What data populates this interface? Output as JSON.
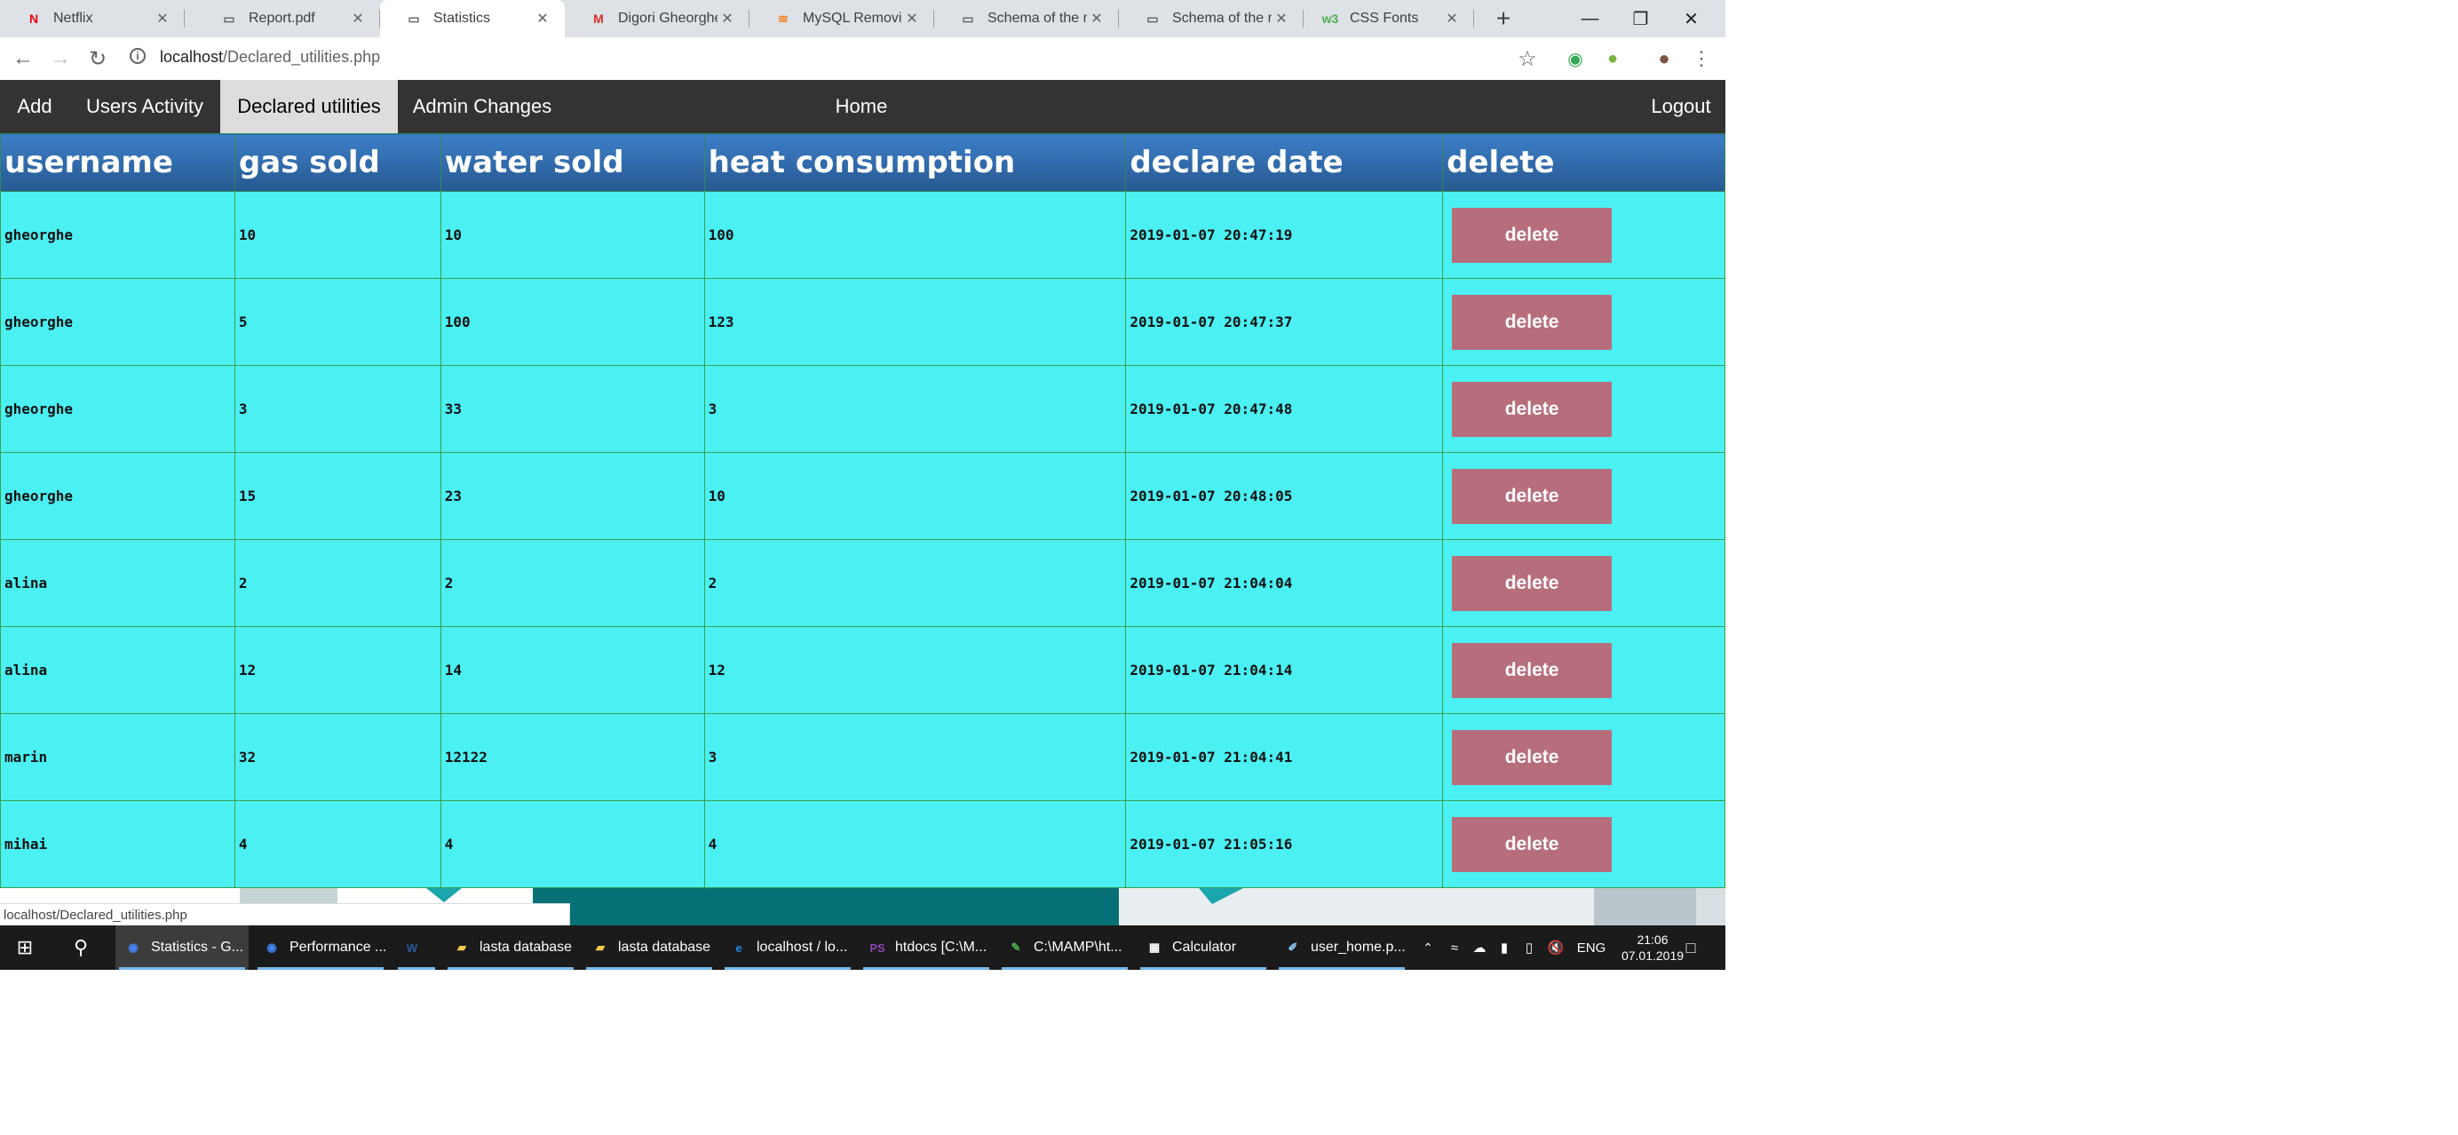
{
  "browser": {
    "tabs": [
      {
        "title": "Netflix",
        "icon": "netflix-icon",
        "glyph": "N",
        "color": "#e50914",
        "active": false
      },
      {
        "title": "Report.pdf",
        "icon": "document-icon",
        "glyph": "▭",
        "color": "#5f6368",
        "active": false
      },
      {
        "title": "Statistics",
        "icon": "document-icon",
        "glyph": "▭",
        "color": "#5f6368",
        "active": true
      },
      {
        "title": "Digori Gheorghe - ",
        "icon": "gmail-icon",
        "glyph": "M",
        "color": "#d93025",
        "active": false
      },
      {
        "title": "MySQL Removing",
        "icon": "stackoverflow-icon",
        "glyph": "≋",
        "color": "#f48024",
        "active": false
      },
      {
        "title": "Schema of the my",
        "icon": "document-icon",
        "glyph": "▭",
        "color": "#5f6368",
        "active": false
      },
      {
        "title": "Schema of the my",
        "icon": "document-icon",
        "glyph": "▭",
        "color": "#5f6368",
        "active": false
      },
      {
        "title": "CSS Fonts",
        "icon": "w3schools-icon",
        "glyph": "w3",
        "color": "#4caf50",
        "active": false
      }
    ],
    "new_tab": "+",
    "url_host": "localhost",
    "url_path": "/Declared_utilities.php",
    "status_url": "localhost/Declared_utilities.php"
  },
  "nav": {
    "add": "Add",
    "users_activity": "Users Activity",
    "declared_utilities": "Declared utilities",
    "admin_changes": "Admin Changes",
    "home": "Home",
    "logout": "Logout"
  },
  "table": {
    "headers": [
      "username",
      "gas sold",
      "water sold",
      "heat consumption",
      "declare date",
      "delete"
    ],
    "delete_label": "delete",
    "rows": [
      [
        "gheorghe",
        "10",
        "10",
        "100",
        "2019-01-07 20:47:19"
      ],
      [
        "gheorghe",
        "5",
        "100",
        "123",
        "2019-01-07 20:47:37"
      ],
      [
        "gheorghe",
        "3",
        "33",
        "3",
        "2019-01-07 20:47:48"
      ],
      [
        "gheorghe",
        "15",
        "23",
        "10",
        "2019-01-07 20:48:05"
      ],
      [
        "alina",
        "2",
        "2",
        "2",
        "2019-01-07 21:04:04"
      ],
      [
        "alina",
        "12",
        "14",
        "12",
        "2019-01-07 21:04:14"
      ],
      [
        "marin",
        "32",
        "12122",
        "3",
        "2019-01-07 21:04:41"
      ],
      [
        "mihai",
        "4",
        "4",
        "4",
        "2019-01-07 21:05:16"
      ]
    ]
  },
  "taskbar": {
    "items": [
      {
        "label": "Statistics - G...",
        "icon": "chrome-icon",
        "glyph": "◉",
        "color": "#4285f4"
      },
      {
        "label": "Performance ...",
        "icon": "chrome-icon",
        "glyph": "◉",
        "color": "#4285f4"
      },
      {
        "label": "",
        "icon": "word-icon",
        "glyph": "W",
        "color": "#2b579a"
      },
      {
        "label": "lasta database",
        "icon": "folder-icon",
        "glyph": "▰",
        "color": "#f2c94c"
      },
      {
        "label": "lasta database",
        "icon": "folder-icon",
        "glyph": "▰",
        "color": "#f2c94c"
      },
      {
        "label": "localhost / lo...",
        "icon": "edge-icon",
        "glyph": "e",
        "color": "#1e88e5"
      },
      {
        "label": "htdocs [C:\\M...",
        "icon": "phpstorm-icon",
        "glyph": "PS",
        "color": "#8e44ad"
      },
      {
        "label": "C:\\MAMP\\ht...",
        "icon": "notepad-icon",
        "glyph": "✎",
        "color": "#4caf50"
      },
      {
        "label": "Calculator",
        "icon": "calculator-icon",
        "glyph": "▦",
        "color": "#ffffff"
      },
      {
        "label": "user_home.p...",
        "icon": "paint-icon",
        "glyph": "✐",
        "color": "#90caf9"
      }
    ],
    "language": "ENG",
    "time": "21:06",
    "date": "07.01.2019"
  }
}
